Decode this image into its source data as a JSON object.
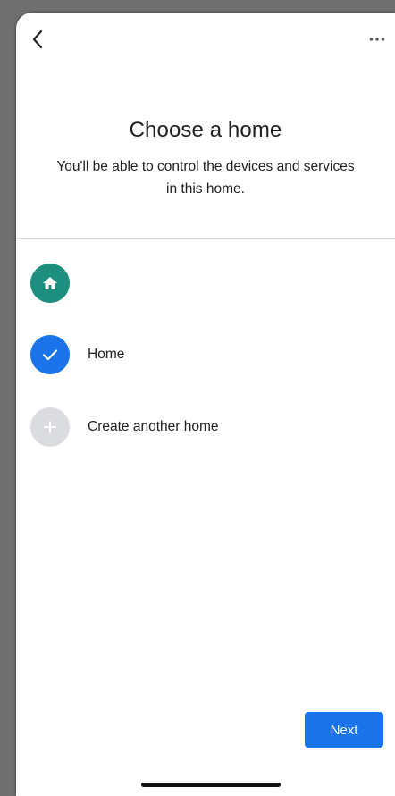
{
  "header": {
    "back_icon": "chevron-left-icon",
    "more_icon": "more-horizontal-icon"
  },
  "page": {
    "title": "Choose a home",
    "subtitle": "You'll be able to control the devices and services in this home."
  },
  "homes": [
    {
      "label": "",
      "icon": "house-icon",
      "color": "#1e8e7e",
      "selected": false
    },
    {
      "label": "Home",
      "icon": "check-icon",
      "color": "#1a73e8",
      "selected": true
    },
    {
      "label": "Create another home",
      "icon": "plus-icon",
      "color": "#dadce0",
      "selected": false
    }
  ],
  "footer": {
    "next_label": "Next",
    "accent": "#1a73e8"
  }
}
